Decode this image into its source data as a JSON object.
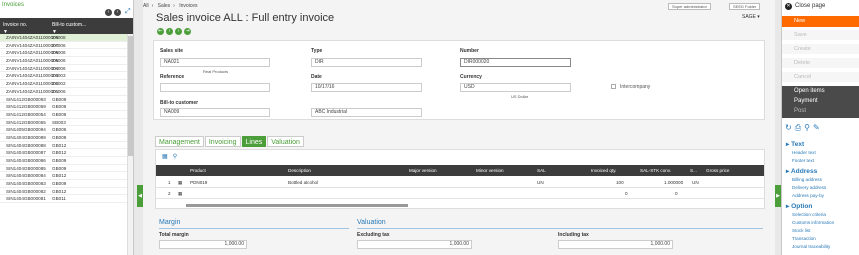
{
  "left_panel": {
    "title": "Invoices",
    "col_invoice": "Invoice no.",
    "col_billto": "Bill-to custom...",
    "rows": [
      {
        "inv": "ZAINV1404ZA011000008",
        "cust": "ZA008"
      },
      {
        "inv": "ZAINV1404ZA011000007",
        "cust": "ZA006"
      },
      {
        "inv": "ZAINV1404ZA011000006",
        "cust": "ZA006"
      },
      {
        "inv": "ZAINV1404ZA011000005",
        "cust": "ZA006"
      },
      {
        "inv": "ZAINV1404ZA011000004",
        "cust": "ZA006"
      },
      {
        "inv": "ZAINV1404ZA011000003",
        "cust": "ZA003"
      },
      {
        "inv": "ZAINV1404ZA011000002",
        "cust": "ZA002"
      },
      {
        "inv": "ZAINV1404ZA011000001",
        "cust": "ZA006"
      },
      {
        "inv": "SIN1412GB000093",
        "cust": "GB009"
      },
      {
        "inv": "SIN1412GB000059",
        "cust": "GB006"
      },
      {
        "inv": "SIN1412GB000054",
        "cust": "GB006"
      },
      {
        "inv": "SIN1412GB000055",
        "cust": "SB003"
      },
      {
        "inv": "SIN1405GB000094",
        "cust": "GB006"
      },
      {
        "inv": "SIN1404GB000089",
        "cust": "GB009"
      },
      {
        "inv": "SIN1404GB000088",
        "cust": "GB012"
      },
      {
        "inv": "SIN1404GB000087",
        "cust": "GB012"
      },
      {
        "inv": "SIN1404GB000086",
        "cust": "GB009"
      },
      {
        "inv": "SIN1404GB000085",
        "cust": "GB009"
      },
      {
        "inv": "SIN1404GB000084",
        "cust": "GB012"
      },
      {
        "inv": "SIN1404GB000083",
        "cust": "GB009"
      },
      {
        "inv": "SIN1404GB000082",
        "cust": "GB012"
      },
      {
        "inv": "SIN1404GB000081",
        "cust": "GB011"
      }
    ]
  },
  "breadcrumb": [
    "All",
    "Sales",
    "Invoices"
  ],
  "title": "Sales invoice ALL : Full entry invoice",
  "top_buttons": {
    "admin": "Super administrator",
    "folder": "SEED Folder"
  },
  "company": "SAGE",
  "header": {
    "sales_site_label": "Sales site",
    "sales_site_value": "NA021",
    "sales_site_desc": "Real Products",
    "type_label": "Type",
    "type_value": "DIR",
    "number_label": "Number",
    "number_value": "DIR000020",
    "reference_label": "Reference",
    "date_label": "Date",
    "date_value": "10/17/16",
    "currency_label": "Currency",
    "currency_value": "USD",
    "currency_desc": "US Dollar",
    "intercompany_label": "Intercompany",
    "billto_label": "Bill-to customer",
    "billto_value": "NA009",
    "billto_name": "ABC Industrial"
  },
  "tabs": [
    "Management",
    "Invoicing",
    "Lines",
    "Valuation"
  ],
  "grid": {
    "columns": [
      "Product",
      "Description",
      "Major version",
      "Minor version",
      "SAL",
      "Invoiced qty.",
      "SAL-STK conv.",
      "S...",
      "Gross price"
    ],
    "rows": [
      {
        "no": "1",
        "product": "PDN019",
        "description": "Bottled alcohol",
        "sal": "UN",
        "qty": "100",
        "conv": "1.000000",
        "s": "UN"
      },
      {
        "no": "2",
        "product": "",
        "description": "",
        "sal": "",
        "qty": "0",
        "conv": "0",
        "s": ""
      }
    ]
  },
  "margin": {
    "title": "Margin",
    "total_label": "Total margin",
    "total_value": "1,000.00"
  },
  "valuation": {
    "title": "Valuation",
    "excl_label": "Excluding tax",
    "excl_value": "1,000.00",
    "incl_label": "Including tax",
    "incl_value": "1,000.00"
  },
  "right_panel": {
    "close": "Close page",
    "new": "New",
    "save": "Save",
    "create": "Create",
    "delete": "Delete",
    "cancel": "Cancel",
    "open_items": "Open items",
    "payment": "Payment",
    "post": "Post",
    "text_title": "Text",
    "text_items": [
      "Header text",
      "Footer text"
    ],
    "address_title": "Address",
    "address_items": [
      "Billing address",
      "Delivery address",
      "Address pay-by"
    ],
    "option_title": "Option",
    "option_items": [
      "Selection criteria",
      "Customs information",
      "Stock list",
      "Transaction",
      "Journal traceability"
    ]
  },
  "colors": {
    "accent": "#4b9e3a",
    "new": "#ff6a00",
    "link": "#2a7ab8",
    "header": "#3c3c3c"
  }
}
